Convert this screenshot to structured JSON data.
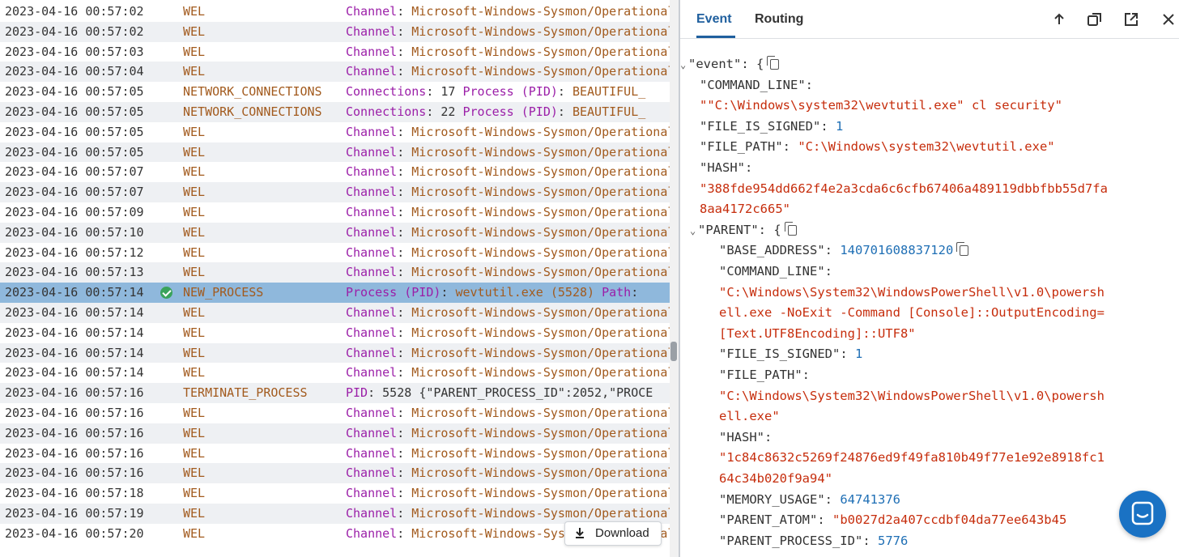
{
  "log": {
    "rows": [
      {
        "ts": "2023-04-16 00:57:02",
        "type": "WEL",
        "f": [
          [
            "Channel",
            "k"
          ],
          [
            ": ",
            "p"
          ],
          [
            "Microsoft-Windows-Sysmon/Operational",
            "v"
          ]
        ]
      },
      {
        "ts": "2023-04-16 00:57:02",
        "type": "WEL",
        "f": [
          [
            "Channel",
            "k"
          ],
          [
            ": ",
            "p"
          ],
          [
            "Microsoft-Windows-Sysmon/Operational",
            "v"
          ]
        ]
      },
      {
        "ts": "2023-04-16 00:57:03",
        "type": "WEL",
        "f": [
          [
            "Channel",
            "k"
          ],
          [
            ": ",
            "p"
          ],
          [
            "Microsoft-Windows-Sysmon/Operational",
            "v"
          ]
        ]
      },
      {
        "ts": "2023-04-16 00:57:04",
        "type": "WEL",
        "f": [
          [
            "Channel",
            "k"
          ],
          [
            ": ",
            "p"
          ],
          [
            "Microsoft-Windows-Sysmon/Operational",
            "v"
          ]
        ]
      },
      {
        "ts": "2023-04-16 00:57:05",
        "type": "NETWORK_CONNECTIONS",
        "f": [
          [
            "Connections",
            "k"
          ],
          [
            ": 17  ",
            "p"
          ],
          [
            "Process (PID)",
            "k"
          ],
          [
            ": ",
            "p"
          ],
          [
            "BEAUTIFUL_",
            "v"
          ]
        ]
      },
      {
        "ts": "2023-04-16 00:57:05",
        "type": "NETWORK_CONNECTIONS",
        "f": [
          [
            "Connections",
            "k"
          ],
          [
            ": 22  ",
            "p"
          ],
          [
            "Process (PID)",
            "k"
          ],
          [
            ": ",
            "p"
          ],
          [
            "BEAUTIFUL_",
            "v"
          ]
        ]
      },
      {
        "ts": "2023-04-16 00:57:05",
        "type": "WEL",
        "f": [
          [
            "Channel",
            "k"
          ],
          [
            ": ",
            "p"
          ],
          [
            "Microsoft-Windows-Sysmon/Operational",
            "v"
          ]
        ]
      },
      {
        "ts": "2023-04-16 00:57:05",
        "type": "WEL",
        "f": [
          [
            "Channel",
            "k"
          ],
          [
            ": ",
            "p"
          ],
          [
            "Microsoft-Windows-Sysmon/Operational",
            "v"
          ]
        ]
      },
      {
        "ts": "2023-04-16 00:57:07",
        "type": "WEL",
        "f": [
          [
            "Channel",
            "k"
          ],
          [
            ": ",
            "p"
          ],
          [
            "Microsoft-Windows-Sysmon/Operational",
            "v"
          ]
        ]
      },
      {
        "ts": "2023-04-16 00:57:07",
        "type": "WEL",
        "f": [
          [
            "Channel",
            "k"
          ],
          [
            ": ",
            "p"
          ],
          [
            "Microsoft-Windows-Sysmon/Operational",
            "v"
          ]
        ]
      },
      {
        "ts": "2023-04-16 00:57:09",
        "type": "WEL",
        "f": [
          [
            "Channel",
            "k"
          ],
          [
            ": ",
            "p"
          ],
          [
            "Microsoft-Windows-Sysmon/Operational",
            "v"
          ]
        ]
      },
      {
        "ts": "2023-04-16 00:57:10",
        "type": "WEL",
        "f": [
          [
            "Channel",
            "k"
          ],
          [
            ": ",
            "p"
          ],
          [
            "Microsoft-Windows-Sysmon/Operational",
            "v"
          ]
        ]
      },
      {
        "ts": "2023-04-16 00:57:12",
        "type": "WEL",
        "f": [
          [
            "Channel",
            "k"
          ],
          [
            ": ",
            "p"
          ],
          [
            "Microsoft-Windows-Sysmon/Operational",
            "v"
          ]
        ]
      },
      {
        "ts": "2023-04-16 00:57:13",
        "type": "WEL",
        "f": [
          [
            "Channel",
            "k"
          ],
          [
            ": ",
            "p"
          ],
          [
            "Microsoft-Windows-Sysmon/Operational",
            "v"
          ]
        ]
      },
      {
        "ts": "2023-04-16 00:57:14",
        "type": "NEW_PROCESS",
        "selected": true,
        "f": [
          [
            "Process (PID)",
            "k"
          ],
          [
            ": ",
            "p"
          ],
          [
            "wevtutil.exe (5528)",
            "v"
          ],
          [
            "   ",
            "p"
          ],
          [
            "Path",
            "k"
          ],
          [
            ":",
            "p"
          ]
        ]
      },
      {
        "ts": "2023-04-16 00:57:14",
        "type": "WEL",
        "f": [
          [
            "Channel",
            "k"
          ],
          [
            ": ",
            "p"
          ],
          [
            "Microsoft-Windows-Sysmon/Operational",
            "v"
          ]
        ]
      },
      {
        "ts": "2023-04-16 00:57:14",
        "type": "WEL",
        "f": [
          [
            "Channel",
            "k"
          ],
          [
            ": ",
            "p"
          ],
          [
            "Microsoft-Windows-Sysmon/Operational",
            "v"
          ]
        ]
      },
      {
        "ts": "2023-04-16 00:57:14",
        "type": "WEL",
        "f": [
          [
            "Channel",
            "k"
          ],
          [
            ": ",
            "p"
          ],
          [
            "Microsoft-Windows-Sysmon/Operational",
            "v"
          ]
        ]
      },
      {
        "ts": "2023-04-16 00:57:14",
        "type": "WEL",
        "f": [
          [
            "Channel",
            "k"
          ],
          [
            ": ",
            "p"
          ],
          [
            "Microsoft-Windows-Sysmon/Operational",
            "v"
          ]
        ]
      },
      {
        "ts": "2023-04-16 00:57:16",
        "type": "TERMINATE_PROCESS",
        "f": [
          [
            "PID",
            "k"
          ],
          [
            ": 5528  ",
            "p"
          ],
          [
            "{\"PARENT_PROCESS_ID\":2052,\"PROCE",
            "p"
          ]
        ]
      },
      {
        "ts": "2023-04-16 00:57:16",
        "type": "WEL",
        "f": [
          [
            "Channel",
            "k"
          ],
          [
            ": ",
            "p"
          ],
          [
            "Microsoft-Windows-Sysmon/Operational",
            "v"
          ]
        ]
      },
      {
        "ts": "2023-04-16 00:57:16",
        "type": "WEL",
        "f": [
          [
            "Channel",
            "k"
          ],
          [
            ": ",
            "p"
          ],
          [
            "Microsoft-Windows-Sysmon/Operational",
            "v"
          ]
        ]
      },
      {
        "ts": "2023-04-16 00:57:16",
        "type": "WEL",
        "f": [
          [
            "Channel",
            "k"
          ],
          [
            ": ",
            "p"
          ],
          [
            "Microsoft-Windows-Sysmon/Operational",
            "v"
          ]
        ]
      },
      {
        "ts": "2023-04-16 00:57:16",
        "type": "WEL",
        "f": [
          [
            "Channel",
            "k"
          ],
          [
            ": ",
            "p"
          ],
          [
            "Microsoft-Windows-Sysmon/Operational",
            "v"
          ]
        ]
      },
      {
        "ts": "2023-04-16 00:57:18",
        "type": "WEL",
        "f": [
          [
            "Channel",
            "k"
          ],
          [
            ": ",
            "p"
          ],
          [
            "Microsoft-Windows-Sysmon/Operational",
            "v"
          ]
        ]
      },
      {
        "ts": "2023-04-16 00:57:19",
        "type": "WEL",
        "f": [
          [
            "Channel",
            "k"
          ],
          [
            ": ",
            "p"
          ],
          [
            "Microsoft-Windows-Sysmon/Operational",
            "v"
          ]
        ]
      },
      {
        "ts": "2023-04-16 00:57:20",
        "type": "WEL",
        "f": [
          [
            "Channel",
            "k"
          ],
          [
            ": ",
            "p"
          ],
          [
            "Microsoft-Windows-Sysmon/Operational",
            "v"
          ]
        ]
      }
    ],
    "download_label": "Download"
  },
  "detail": {
    "tabs": {
      "event": "Event",
      "routing": "Routing"
    },
    "lines": [
      {
        "indent": 0,
        "caret": "⌄",
        "parts": [
          [
            "\"event\"",
            "key"
          ],
          [
            ": {",
            "p"
          ]
        ],
        "copy": true
      },
      {
        "indent": 1,
        "parts": [
          [
            "\"COMMAND_LINE\"",
            "key"
          ],
          [
            ":",
            "p"
          ]
        ]
      },
      {
        "indent": 1,
        "parts": [
          [
            "\"\"C:\\Windows\\system32\\wevtutil.exe\" cl security\"",
            "str"
          ]
        ]
      },
      {
        "indent": 1,
        "parts": [
          [
            "\"FILE_IS_SIGNED\"",
            "key"
          ],
          [
            ": ",
            "p"
          ],
          [
            "1",
            "num"
          ]
        ]
      },
      {
        "indent": 1,
        "parts": [
          [
            "\"FILE_PATH\"",
            "key"
          ],
          [
            ": ",
            "p"
          ],
          [
            "\"C:\\Windows\\system32\\wevtutil.exe\"",
            "str"
          ]
        ]
      },
      {
        "indent": 1,
        "parts": [
          [
            "\"HASH\"",
            "key"
          ],
          [
            ":",
            "p"
          ]
        ]
      },
      {
        "indent": 1,
        "parts": [
          [
            "\"388fde954dd662f4e2a3cda6c6cfb67406a489119dbbfbb55d7fa",
            "str"
          ]
        ]
      },
      {
        "indent": 1,
        "parts": [
          [
            "8aa4172c665\"",
            "str"
          ]
        ]
      },
      {
        "indent": 1,
        "caret": "⌄",
        "parts": [
          [
            "\"PARENT\"",
            "key"
          ],
          [
            ": {",
            "p"
          ]
        ],
        "copy": true
      },
      {
        "indent": 2,
        "parts": [
          [
            "\"BASE_ADDRESS\"",
            "key"
          ],
          [
            ": ",
            "p"
          ],
          [
            "140701608837120",
            "num"
          ]
        ],
        "copy": true
      },
      {
        "indent": 2,
        "parts": [
          [
            "\"COMMAND_LINE\"",
            "key"
          ],
          [
            ":",
            "p"
          ]
        ]
      },
      {
        "indent": 2,
        "parts": [
          [
            "\"C:\\Windows\\System32\\WindowsPowerShell\\v1.0\\powersh",
            "str"
          ]
        ]
      },
      {
        "indent": 2,
        "parts": [
          [
            "ell.exe -NoExit -Command [Console]::OutputEncoding=",
            "str"
          ]
        ]
      },
      {
        "indent": 2,
        "parts": [
          [
            "[Text.UTF8Encoding]::UTF8\"",
            "str"
          ]
        ]
      },
      {
        "indent": 2,
        "parts": [
          [
            "\"FILE_IS_SIGNED\"",
            "key"
          ],
          [
            ": ",
            "p"
          ],
          [
            "1",
            "num"
          ]
        ]
      },
      {
        "indent": 2,
        "parts": [
          [
            "\"FILE_PATH\"",
            "key"
          ],
          [
            ":",
            "p"
          ]
        ]
      },
      {
        "indent": 2,
        "parts": [
          [
            "\"C:\\Windows\\System32\\WindowsPowerShell\\v1.0\\powersh",
            "str"
          ]
        ]
      },
      {
        "indent": 2,
        "parts": [
          [
            "ell.exe\"",
            "str"
          ]
        ]
      },
      {
        "indent": 2,
        "parts": [
          [
            "\"HASH\"",
            "key"
          ],
          [
            ":",
            "p"
          ]
        ]
      },
      {
        "indent": 2,
        "parts": [
          [
            "\"1c84c8632c5269f24876ed9f49fa810b49f77e1e92e8918fc1",
            "str"
          ]
        ]
      },
      {
        "indent": 2,
        "parts": [
          [
            "64c34b020f9a94\"",
            "str"
          ]
        ]
      },
      {
        "indent": 2,
        "parts": [
          [
            "\"MEMORY_USAGE\"",
            "key"
          ],
          [
            ": ",
            "p"
          ],
          [
            "64741376",
            "num"
          ]
        ]
      },
      {
        "indent": 2,
        "parts": [
          [
            "\"PARENT_ATOM\"",
            "key"
          ],
          [
            ": ",
            "p"
          ],
          [
            "\"b0027d2a407ccdbf04da77ee643b45",
            "str"
          ]
        ]
      },
      {
        "indent": 2,
        "parts": [
          [
            "\"PARENT_PROCESS_ID\"",
            "key"
          ],
          [
            ": ",
            "p"
          ],
          [
            "5776",
            "num"
          ]
        ]
      }
    ]
  },
  "icons": {
    "toolbar": [
      "arrow-up-icon",
      "copy-window-icon",
      "open-external-icon",
      "close-icon"
    ],
    "download": "download-icon",
    "chat": "chat-icon"
  },
  "colors": {
    "selected_row": "#8fb8dc",
    "accent": "#1f5f9e",
    "key": "#9b1fa8",
    "value": "#a25a1d",
    "json_string": "#c62d0c",
    "json_number": "#1f6fb5",
    "check": "#3aa35b"
  }
}
